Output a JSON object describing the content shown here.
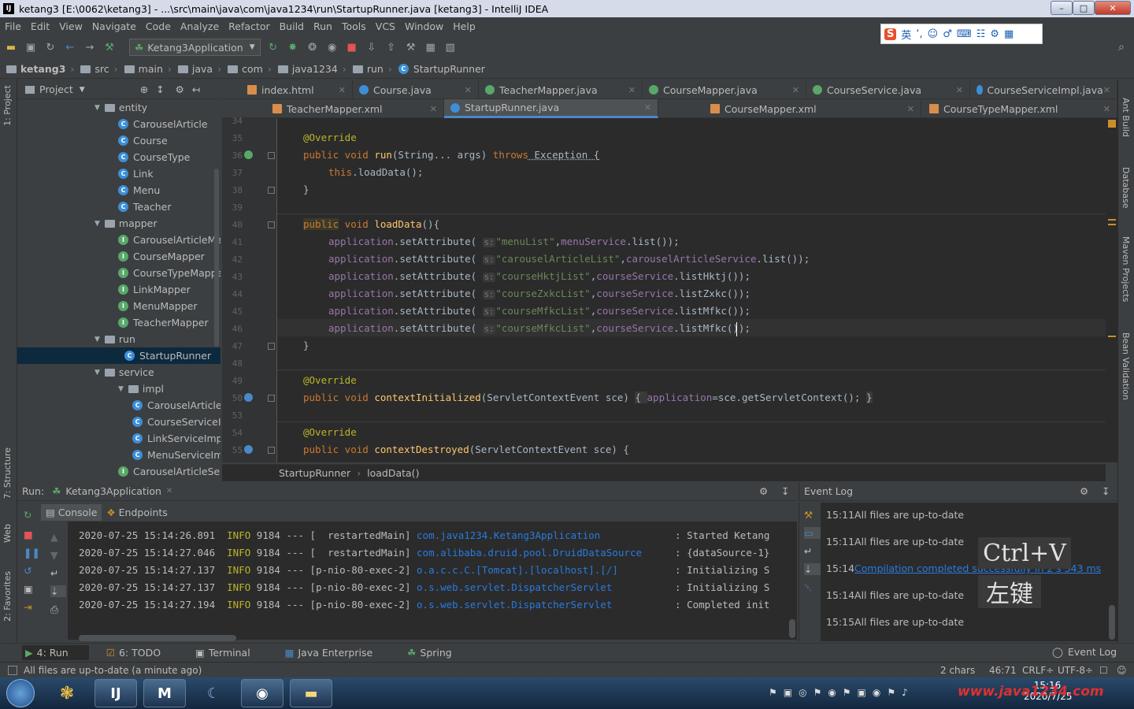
{
  "window": {
    "title": "ketang3 [E:\\0062\\ketang3] - ...\\src\\main\\java\\com\\java1234\\run\\StartupRunner.java [ketang3] - IntelliJ IDEA",
    "logo": "IJ"
  },
  "menu": [
    "File",
    "Edit",
    "View",
    "Navigate",
    "Code",
    "Analyze",
    "Refactor",
    "Build",
    "Run",
    "Tools",
    "VCS",
    "Window",
    "Help"
  ],
  "toolbar": {
    "run_config": "Ketang3Application"
  },
  "ime": {
    "items": [
      "英",
      "‘,",
      "☺",
      "♂",
      "⌨",
      "☷",
      "⚙",
      "▦"
    ]
  },
  "navbar": [
    "ketang3",
    "src",
    "main",
    "java",
    "com",
    "java1234",
    "run",
    "StartupRunner"
  ],
  "left_strip": {
    "project": "1: Project",
    "structure": "7: Structure",
    "web": "Web",
    "favorites": "2: Favorites"
  },
  "right_strip": {
    "ant": "Ant Build",
    "database": "Database",
    "maven": "Maven Projects",
    "bean": "Bean Validation"
  },
  "project_panel": {
    "title": "Project"
  },
  "tree": [
    {
      "label": "entity",
      "kind": "folder",
      "depth": 0
    },
    {
      "label": "CarouselArticle",
      "kind": "class",
      "depth": 1
    },
    {
      "label": "Course",
      "kind": "class",
      "depth": 1
    },
    {
      "label": "CourseType",
      "kind": "class",
      "depth": 1
    },
    {
      "label": "Link",
      "kind": "class",
      "depth": 1
    },
    {
      "label": "Menu",
      "kind": "class",
      "depth": 1
    },
    {
      "label": "Teacher",
      "kind": "class",
      "depth": 1
    },
    {
      "label": "mapper",
      "kind": "folder",
      "depth": 0
    },
    {
      "label": "CarouselArticleMap",
      "kind": "interface",
      "depth": 1
    },
    {
      "label": "CourseMapper",
      "kind": "interface",
      "depth": 1
    },
    {
      "label": "CourseTypeMappe",
      "kind": "interface",
      "depth": 1
    },
    {
      "label": "LinkMapper",
      "kind": "interface",
      "depth": 1
    },
    {
      "label": "MenuMapper",
      "kind": "interface",
      "depth": 1
    },
    {
      "label": "TeacherMapper",
      "kind": "interface",
      "depth": 1
    },
    {
      "label": "run",
      "kind": "folder",
      "depth": 0
    },
    {
      "label": "StartupRunner",
      "kind": "class",
      "depth": 1,
      "selected": true
    },
    {
      "label": "service",
      "kind": "folder",
      "depth": 0
    },
    {
      "label": "impl",
      "kind": "folder",
      "depth": 1
    },
    {
      "label": "CarouselArticleS",
      "kind": "class",
      "depth": 2
    },
    {
      "label": "CourseServiceIn",
      "kind": "class",
      "depth": 2
    },
    {
      "label": "LinkServiceImpl",
      "kind": "class",
      "depth": 2
    },
    {
      "label": "MenuServiceImp",
      "kind": "class",
      "depth": 2
    },
    {
      "label": "CarouselArticleServ",
      "kind": "interface",
      "depth": 1
    }
  ],
  "tabs_row1": [
    "index.html",
    "Course.java",
    "TeacherMapper.java",
    "CourseMapper.java",
    "CourseService.java",
    "CourseServiceImpl.java"
  ],
  "tabs_row2": [
    "TeacherMapper.xml",
    "StartupRunner.java",
    "CourseMapper.xml",
    "CourseTypeMapper.xml"
  ],
  "code": {
    "lines": [
      "34",
      "35",
      "36",
      "37",
      "38",
      "39",
      "40",
      "41",
      "42",
      "43",
      "44",
      "45",
      "46",
      "47",
      "48",
      "49",
      "50",
      "53",
      "54",
      "55"
    ],
    "override": "@Override",
    "l36a": "public",
    "l36b": " void ",
    "l36c": "run",
    "l36d": "(String... args) ",
    "l36e": "throws",
    "l36f": " Exception {",
    "l37a": "this",
    ".": ".",
    "l37b": ".loadData();",
    "brace": "}",
    "l40a": "public",
    "l40b": " void ",
    "l40c": "loadData",
    "l40d": "(){",
    "app": "application",
    "set": ".setAttribute(",
    "hint": "s:",
    "a1s": "\"menuList\"",
    "a1f": "menuService",
    "a1m": ".list());",
    "a2s": "\"carouselArticleList\"",
    "a2f": "carouselArticleService",
    "a2m": ".list());",
    "a3s": "\"courseHktjList\"",
    "a3f": "courseService",
    "a3m": ".listHktj());",
    "a4s": "\"courseZxkcList\"",
    "a4m": ".listZxkc());",
    "a5s": "\"courseMfkcList\"",
    "a5m": ".listMfkc());",
    "a6m": ".listMfkc());",
    "l50c": "contextInitialized",
    "l50d": "(ServletContextEvent sce) ",
    "l50e": "{ ",
    "l50f": "=sce.getServletContext(); ",
    "l50g": "}",
    "l55c": "contextDestroyed",
    "l55d": "(ServletContextEvent sce) {",
    "comma": ","
  },
  "editor_breadcrumb": [
    "StartupRunner",
    "loadData()"
  ],
  "run": {
    "label": "Run:",
    "config": "Ketang3Application",
    "console": "Console",
    "endpoints": "Endpoints"
  },
  "log": [
    {
      "ts": "2020-07-25 15:14:26.891",
      "lvl": "INFO",
      "pid": "9184",
      "sep": "---",
      "thread": "[  restartedMain]",
      "logger": "com.java1234.Ketang3Application",
      "msg": ": Started Ketang"
    },
    {
      "ts": "2020-07-25 15:14:27.046",
      "lvl": "INFO",
      "pid": "9184",
      "sep": "---",
      "thread": "[  restartedMain]",
      "logger": "com.alibaba.druid.pool.DruidDataSource",
      "msg": ": {dataSource-1}"
    },
    {
      "ts": "2020-07-25 15:14:27.137",
      "lvl": "INFO",
      "pid": "9184",
      "sep": "---",
      "thread": "[p-nio-80-exec-2]",
      "logger": "o.a.c.c.C.[Tomcat].[localhost].[/]",
      "msg": ": Initializing S"
    },
    {
      "ts": "2020-07-25 15:14:27.137",
      "lvl": "INFO",
      "pid": "9184",
      "sep": "---",
      "thread": "[p-nio-80-exec-2]",
      "logger": "o.s.web.servlet.DispatcherServlet",
      "msg": ": Initializing S"
    },
    {
      "ts": "2020-07-25 15:14:27.194",
      "lvl": "INFO",
      "pid": "9184",
      "sep": "---",
      "thread": "[p-nio-80-exec-2]",
      "logger": "o.s.web.servlet.DispatcherServlet",
      "msg": ": Completed init"
    }
  ],
  "event_log": {
    "title": "Event Log",
    "entries": [
      {
        "time": "15:11",
        "text": "All files are up-to-date",
        "link": false
      },
      {
        "time": "15:11",
        "text": "All files are up-to-date",
        "link": false
      },
      {
        "time": "15:14",
        "text": "Compilation completed successfully in 2 s 343 ms",
        "link": true
      },
      {
        "time": "15:14",
        "text": "All files are up-to-date",
        "link": false
      },
      {
        "time": "15:15",
        "text": "All files are up-to-date",
        "link": false
      }
    ]
  },
  "overlay": {
    "shortcut": "Ctrl+V",
    "mouse": "左键"
  },
  "bottom_tabs": [
    "4: Run",
    "6: TODO",
    "Terminal",
    "Java Enterprise",
    "Spring"
  ],
  "bottom_right": "Event Log",
  "status": {
    "message": "All files are up-to-date (a minute ago)",
    "chars": "2 chars",
    "pos": "46:71",
    "crlf": "CRLF÷",
    "enc": "UTF-8÷"
  },
  "taskbar": {
    "time": "15:16",
    "date": "2020/7/25",
    "watermark": "www.java1234.com"
  }
}
